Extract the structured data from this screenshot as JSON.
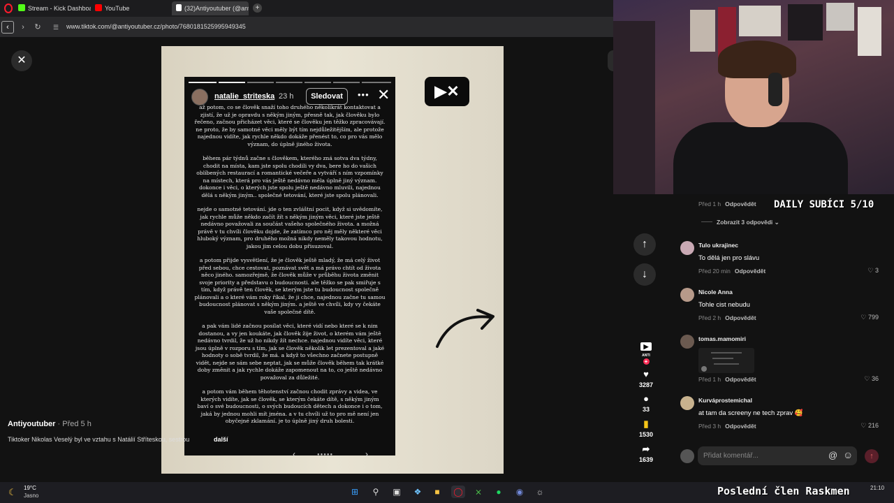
{
  "browser": {
    "tabs": [
      {
        "label": "Stream - Kick Dashboard",
        "color": "#53fc18"
      },
      {
        "label": "YouTube",
        "color": "#ff0000"
      },
      {
        "label": "(32)Antiyoutuber (@antiy",
        "color": "#ffffff"
      }
    ],
    "new_tab": "+",
    "url": "www.tiktok.com/@antiyoutuber.cz/photo/7680181525995949345"
  },
  "story": {
    "username": "natalie_striteska",
    "time": "23 h",
    "follow_label": "Sledovat",
    "paragraphs": [
      "až potom, co se člověk snaží toho druhého několikrát kontaktovat a zjistí, že už je opravdu s někým jiným, přesně tak, jak člověku bylo řečeno, začnou přicházet věci, které se člověku jen těžko zpracovávají. ne proto, že by samotné věci měly být tím nejdůležitějším, ale protože najednou vidíte, jak rychle někdo dokáže přenést to, co pro vás mělo význam, do úplně jiného života.",
      "během pár týdnů začne s člověkem, kterého zná sotva dva týdny, chodit na místa, kam jste spolu chodili vy dva, bere ho do vašich oblíbených restaurací a romantické večeře a vytváří s ním vzpomínky na místech, která pro vás ještě nedávno měla úplně jiný význam. dokonce i věci, o kterých jste spolu ještě nedávno mluvili, najednou dělá s někým jiným.. společné tetování, které jste spolu plánovali.",
      "nejde o samotné tetování. jde o ten zvláštní pocit, když si uvědomíte, jak rychle může někdo začít žít s někým jiným věci, které jste ještě nedávno považovali za součást vašeho společného života. a možná právě v tu chvíli člověku dojde, že zatímco pro něj měly některé věci hluboký význam, pro druhého možná nikdy neměly takovou hodnotu, jakou jim celou dobu přisuzoval.",
      "a potom přijde vysvětlení, že je člověk ještě mladý, že má celý život před sebou, chce cestovat, poznávat svět a má právo chtít od života něco jiného. samozřejmě, že člověk může v průběhu života změnit svoje priority a představu o budoucnosti. ale těžko se pak smiřuje s tím, když právě ten člověk, se kterým jste tu budoucnost společně plánovali a o které vám roky říkal, že ji chce, najednou začne tu samou budoucnost plánovat s někým jiným. a ještě ve chvíli, kdy vy čekáte vaše společné dítě.",
      "a pak vám lidé začnou posílat věci, které vidí nebo které se k nim dostanou, a vy jen koukáte, jak člověk žije život, o kterém vám ještě nedávno tvrdil, že už ho nikdy žít nechce. najednou vidíte věci, které jsou úplně v rozporu s tím, jak se člověk několik let prezentoval a jaké hodnoty o sobě tvrdil, že má. a když to všechno začnete postupně vidět, nejde se sám sebe neptat, jak se může člověk během tak krátké doby změnit a jak rychle dokáže zapomenout na to, co ještě nedávno považoval za důležité.",
      "a potom vám během těhotenství začnou chodit zprávy a videa, ve kterých vidíte, jak se člověk, se kterým čekáte dítě, s někým jiným baví o své budoucnosti, o svých budoucích dětech a dokonce i o tom, jaká by jednou mohli mít jména. a v tu chvíli už to pro mě není jen obyčejné zklamání. je to úplně jiný druh bolesti."
    ]
  },
  "logo_badge": "▶✕",
  "post": {
    "author": "Antiyoutuber",
    "posted": "Před 5 h",
    "description": "Tiktoker Nikolas Veselý byl ve vztahu s Natálií Stříteskou, sestrou",
    "more_label": "další"
  },
  "side_actions": {
    "channel_label": "ANTI",
    "likes": "3287",
    "comments": "33",
    "saves": "1530",
    "shares": "1639"
  },
  "comments": {
    "top_meta": {
      "time": "Před 1 h",
      "reply": "Odpovědět"
    },
    "show_replies": "Zobrazit 3 odpovědi",
    "items": [
      {
        "name": "Tulo ukrajinec",
        "text": "To dělá jen pro slávu",
        "time": "Před 20 min",
        "reply": "Odpovědět",
        "likes": "3",
        "avatar": "#c9a9b4"
      },
      {
        "name": "Nicole Anna",
        "text": "Tohle cist nebudu",
        "time": "Před 2 h",
        "reply": "Odpovědět",
        "likes": "799",
        "avatar": "#b79a8a"
      },
      {
        "name": "tomas.mamomiri",
        "text": "",
        "time": "Před 1 h",
        "reply": "Odpovědět",
        "likes": "36",
        "avatar": "#6b5a50"
      },
      {
        "name": "Kurváprostemichal",
        "text": "at tam da screeny ne tech zprav 🥰",
        "time": "Před 3 h",
        "reply": "Odpovědět",
        "likes": "216",
        "avatar": "#c8b28e"
      }
    ],
    "input_placeholder": "Přidat komentář..."
  },
  "overlays": {
    "daily": "DAILY SUBÍCI 5/10",
    "bottom": "Poslední člen Raskmen"
  },
  "taskbar": {
    "temperature": "19°C",
    "condition": "Jasno",
    "clock": "21:10"
  }
}
